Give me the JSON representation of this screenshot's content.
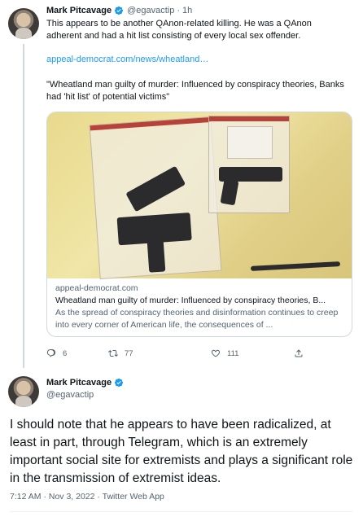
{
  "tweet1": {
    "author": "Mark Pitcavage",
    "handle": "@egavactip",
    "separator": "·",
    "time": "1h",
    "text": "This appears to be another QAnon-related killing. He was a QAnon adherent and had a hit list consisting of every local sex offender.",
    "link": "appeal-democrat.com/news/wheatland…",
    "quote": "\"Wheatland man guilty of murder: Influenced by conspiracy theories, Banks had 'hit list' of potential victims\"",
    "card": {
      "domain": "appeal-democrat.com",
      "title": "Wheatland man guilty of murder: Influenced by conspiracy theories, B...",
      "description": "As the spread of conspiracy theories and disinformation continues to creep into every corner of American life, the consequences of ..."
    },
    "actions": {
      "replies": "6",
      "retweets": "77",
      "likes": "111"
    }
  },
  "tweet2": {
    "author": "Mark Pitcavage",
    "handle": "@egavactip",
    "text": "I should note that he appears to have been radicalized, at least in part, through Telegram, which is an extremely important social site for extremists and plays a significant role in the transmission of extremist ideas.",
    "timestamp": "7:12 AM · Nov 3, 2022 · Twitter Web App"
  },
  "colors": {
    "accent": "#1d9bf0",
    "secondary_text": "#536471",
    "primary_text": "#0f1419",
    "border": "#cfd9de"
  },
  "icons": [
    "verified-badge-icon",
    "reply-icon",
    "retweet-icon",
    "like-icon",
    "share-icon"
  ]
}
